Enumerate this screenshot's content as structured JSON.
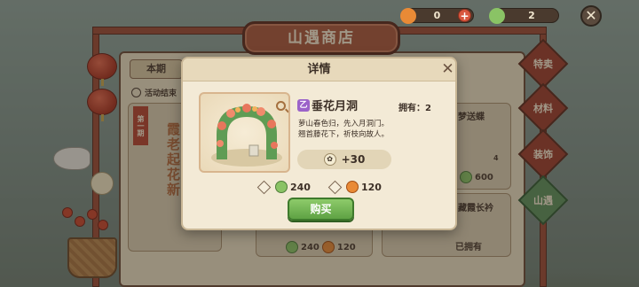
{
  "hud": {
    "resource_1_value": "0",
    "resource_2_value": "2",
    "resource_1_icon": "persimmon-icon",
    "resource_2_icon": "leaf-coin-icon"
  },
  "shop": {
    "title": "山遇商店",
    "tab_week": "本期",
    "event_end": "活动结束",
    "banner_text": "第一期",
    "vertical_title": "霞老起花新"
  },
  "side_tabs": [
    {
      "label": "特卖"
    },
    {
      "label": "材料"
    },
    {
      "label": "装饰"
    },
    {
      "label": "山遇"
    }
  ],
  "cards": {
    "card_right_top_name": "梦送蝶",
    "card_right_top_count": "4",
    "card_right_top_price": "600",
    "card_mid_bottom_price_green": "240",
    "card_mid_bottom_price_orange": "120",
    "card_right_bottom_name": "藏霞长衿",
    "card_right_bottom_status": "已拥有"
  },
  "modal": {
    "title": "详情",
    "close_icon": "close-icon",
    "rarity": "乙",
    "item_name": "垂花月洞",
    "owned_label": "拥有：2",
    "description_line_1": "萝山春色归，先入月洞门。",
    "description_line_2": "翘首藤花下，祈枝向故人。",
    "reward_value": "+30",
    "price_green": "240",
    "price_orange": "120",
    "buy_label": "购买"
  },
  "colors": {
    "accent_green": "#5fa244",
    "accent_red": "#9b3d2b",
    "panel_bg": "#f3ead6"
  }
}
